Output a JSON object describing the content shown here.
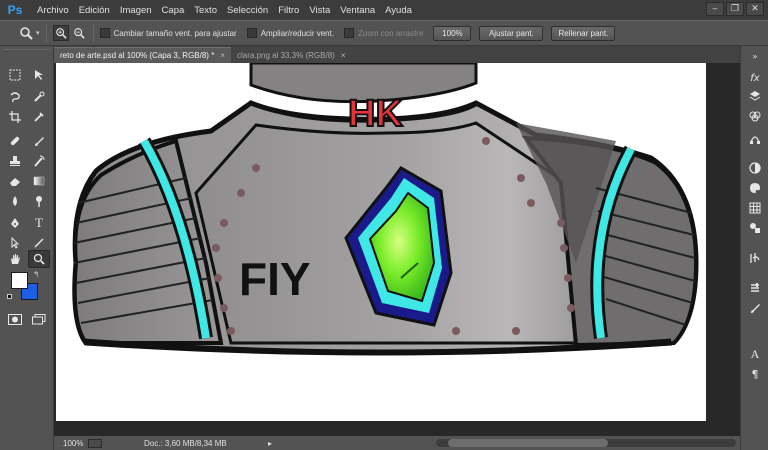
{
  "app": {
    "logo": "Ps"
  },
  "menu": [
    "Archivo",
    "Edición",
    "Imagen",
    "Capa",
    "Texto",
    "Selección",
    "Filtro",
    "Vista",
    "Ventana",
    "Ayuda"
  ],
  "window_controls": [
    "minimize-icon",
    "restore-icon",
    "close-icon"
  ],
  "options": {
    "tool_icon": "zoom-icon",
    "zoom_in_icon": "zoom-in-icon",
    "zoom_out_icon": "zoom-out-icon",
    "resize_windows_label": "Cambiar tamaño vent. para ajustar",
    "zoom_all_label": "Ampliar/reducir vent.",
    "scrubby_zoom_label": "Zoom con arrastre",
    "btn_100": "100%",
    "btn_fit": "Ajustar pant.",
    "btn_fill": "Rellenar pant."
  },
  "tabs": [
    {
      "label": "reto de arte.psd al 100% (Capa 3, RGB/8) *",
      "active": true
    },
    {
      "label": "clara.png al 33,3% (RGB/8)",
      "active": false
    }
  ],
  "tools": [
    "marquee-icon",
    "move-icon",
    "lasso-icon",
    "quick-select-icon",
    "crop-icon",
    "eyedropper-icon",
    "healing-icon",
    "brush-icon",
    "stamp-icon",
    "history-brush-icon",
    "eraser-icon",
    "gradient-icon",
    "blur-icon",
    "dodge-icon",
    "pen-icon",
    "type-icon",
    "path-select-icon",
    "line-icon",
    "hand-icon",
    "zoom-icon",
    "mask-mode-icon",
    "screen-mode-icon"
  ],
  "colors": {
    "foreground": "#ffffff",
    "background": "#1a5fe6"
  },
  "artwork": {
    "chest_letters": "HK",
    "side_letters": "FIY"
  },
  "right_panel": [
    "collapse-icon",
    "fx-icon",
    "layers-icon",
    "channels-icon",
    "paths-icon",
    "color-icon",
    "palette-icon",
    "swatches-icon",
    "adjustments-icon",
    "history-icon",
    "tool-presets-icon",
    "brush-icon",
    "character-icon",
    "paragraph-icon"
  ],
  "status": {
    "zoom": "100%",
    "doc_info": "Doc.: 3,60 MB/8,34 MB"
  }
}
